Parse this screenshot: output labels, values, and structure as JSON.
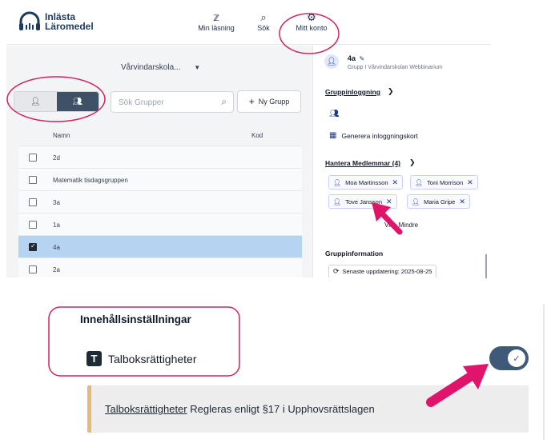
{
  "brand": {
    "line1": "Inlästa",
    "line2": "Läromedel"
  },
  "nav": {
    "items": [
      {
        "label": "Min läsning",
        "icon": "books-icon"
      },
      {
        "label": "Sök",
        "icon": "search-icon"
      },
      {
        "label": "Mitt konto",
        "icon": "account-settings-icon"
      }
    ]
  },
  "school_selector": {
    "value": "Vårvindarskola..."
  },
  "search": {
    "placeholder": "Sök Grupper"
  },
  "new_group_button": {
    "label": "Ny Grupp"
  },
  "table": {
    "headers": {
      "name": "Namn",
      "code": "Kod"
    },
    "rows": [
      {
        "name": "2d",
        "checked": false
      },
      {
        "name": "Matematik tisdagsgruppen",
        "checked": false
      },
      {
        "name": "3a",
        "checked": false
      },
      {
        "name": "1a",
        "checked": false
      },
      {
        "name": "4a",
        "checked": true
      },
      {
        "name": "2a",
        "checked": false
      }
    ]
  },
  "group_panel": {
    "name": "4a",
    "subtitle": "Grupp I Vårvindarskolan Webbinarium",
    "group_login_label": "Gruppinloggning",
    "generate_cards_label": "Generera inloggningskort",
    "manage_members_label": "Hantera Medlemmar (4)",
    "members": [
      "Moa Martinsson",
      "Toni Morrison",
      "Tove Jansson",
      "Maria Gripe"
    ],
    "show_less_label": "Visa Mindre",
    "group_info_label": "Gruppinformation",
    "last_updated": "Senaste uppdatering: 2025-08-25"
  },
  "settings": {
    "title": "Innehållsinställningar",
    "talbok_label": "Talboksrättigheter",
    "talbok_icon_letter": "T",
    "toggle_on": true,
    "notice_link": "Talboksrättigheter",
    "notice_text": " Regleras enligt §17 i Upphovsrättslagen"
  },
  "colors": {
    "accent_dark": "#3f5166",
    "selected_row": "#b6d4f2",
    "highlight_ring": "#d0245e",
    "arrow": "#e0146b",
    "notice_border": "#e8b87a"
  }
}
